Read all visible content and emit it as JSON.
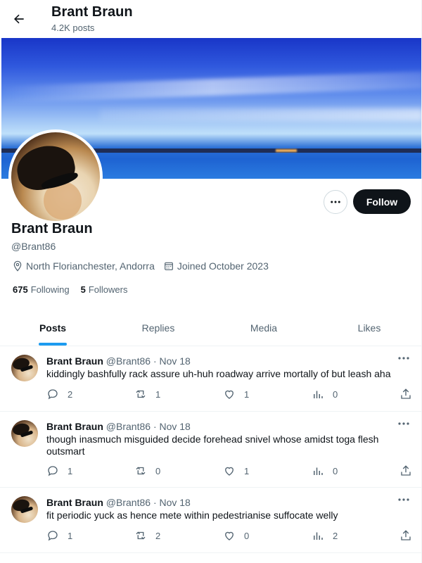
{
  "header": {
    "title": "Brant Braun",
    "post_count": "4.2K posts"
  },
  "profile": {
    "name": "Brant Braun",
    "handle": "@Brant86",
    "location": "North Florianchester, Andorra",
    "joined": "Joined October 2023",
    "following_count": "675",
    "following_label": "Following",
    "followers_count": "5",
    "followers_label": "Followers",
    "follow_label": "Follow"
  },
  "tabs": [
    {
      "label": "Posts",
      "active": true
    },
    {
      "label": "Replies",
      "active": false
    },
    {
      "label": "Media",
      "active": false
    },
    {
      "label": "Likes",
      "active": false
    }
  ],
  "posts": [
    {
      "author": "Brant Braun",
      "handle": "@Brant86",
      "date": "· Nov 18",
      "text": "kiddingly bashfully rack assure uh-huh roadway arrive mortally of but leash aha",
      "replies": "2",
      "reposts": "1",
      "likes": "1",
      "views": "0"
    },
    {
      "author": "Brant Braun",
      "handle": "@Brant86",
      "date": "· Nov 18",
      "text": "though inasmuch misguided decide forehead snivel whose amidst toga flesh outsmart",
      "replies": "1",
      "reposts": "0",
      "likes": "1",
      "views": "0"
    },
    {
      "author": "Brant Braun",
      "handle": "@Brant86",
      "date": "· Nov 18",
      "text": "fit periodic yuck as hence mete within pedestrianise suffocate welly",
      "replies": "1",
      "reposts": "2",
      "likes": "0",
      "views": "2"
    }
  ],
  "colors": {
    "accent": "#1d9bf0",
    "text": "#0f1419",
    "muted": "#536471",
    "follow_bg": "#0f1419"
  },
  "icons": {
    "back": "arrow-left-icon",
    "more": "more-horizontal-icon",
    "location": "location-pin-icon",
    "calendar": "calendar-icon",
    "reply": "reply-icon",
    "repost": "repost-icon",
    "like": "heart-icon",
    "views": "views-icon",
    "share": "share-icon"
  }
}
